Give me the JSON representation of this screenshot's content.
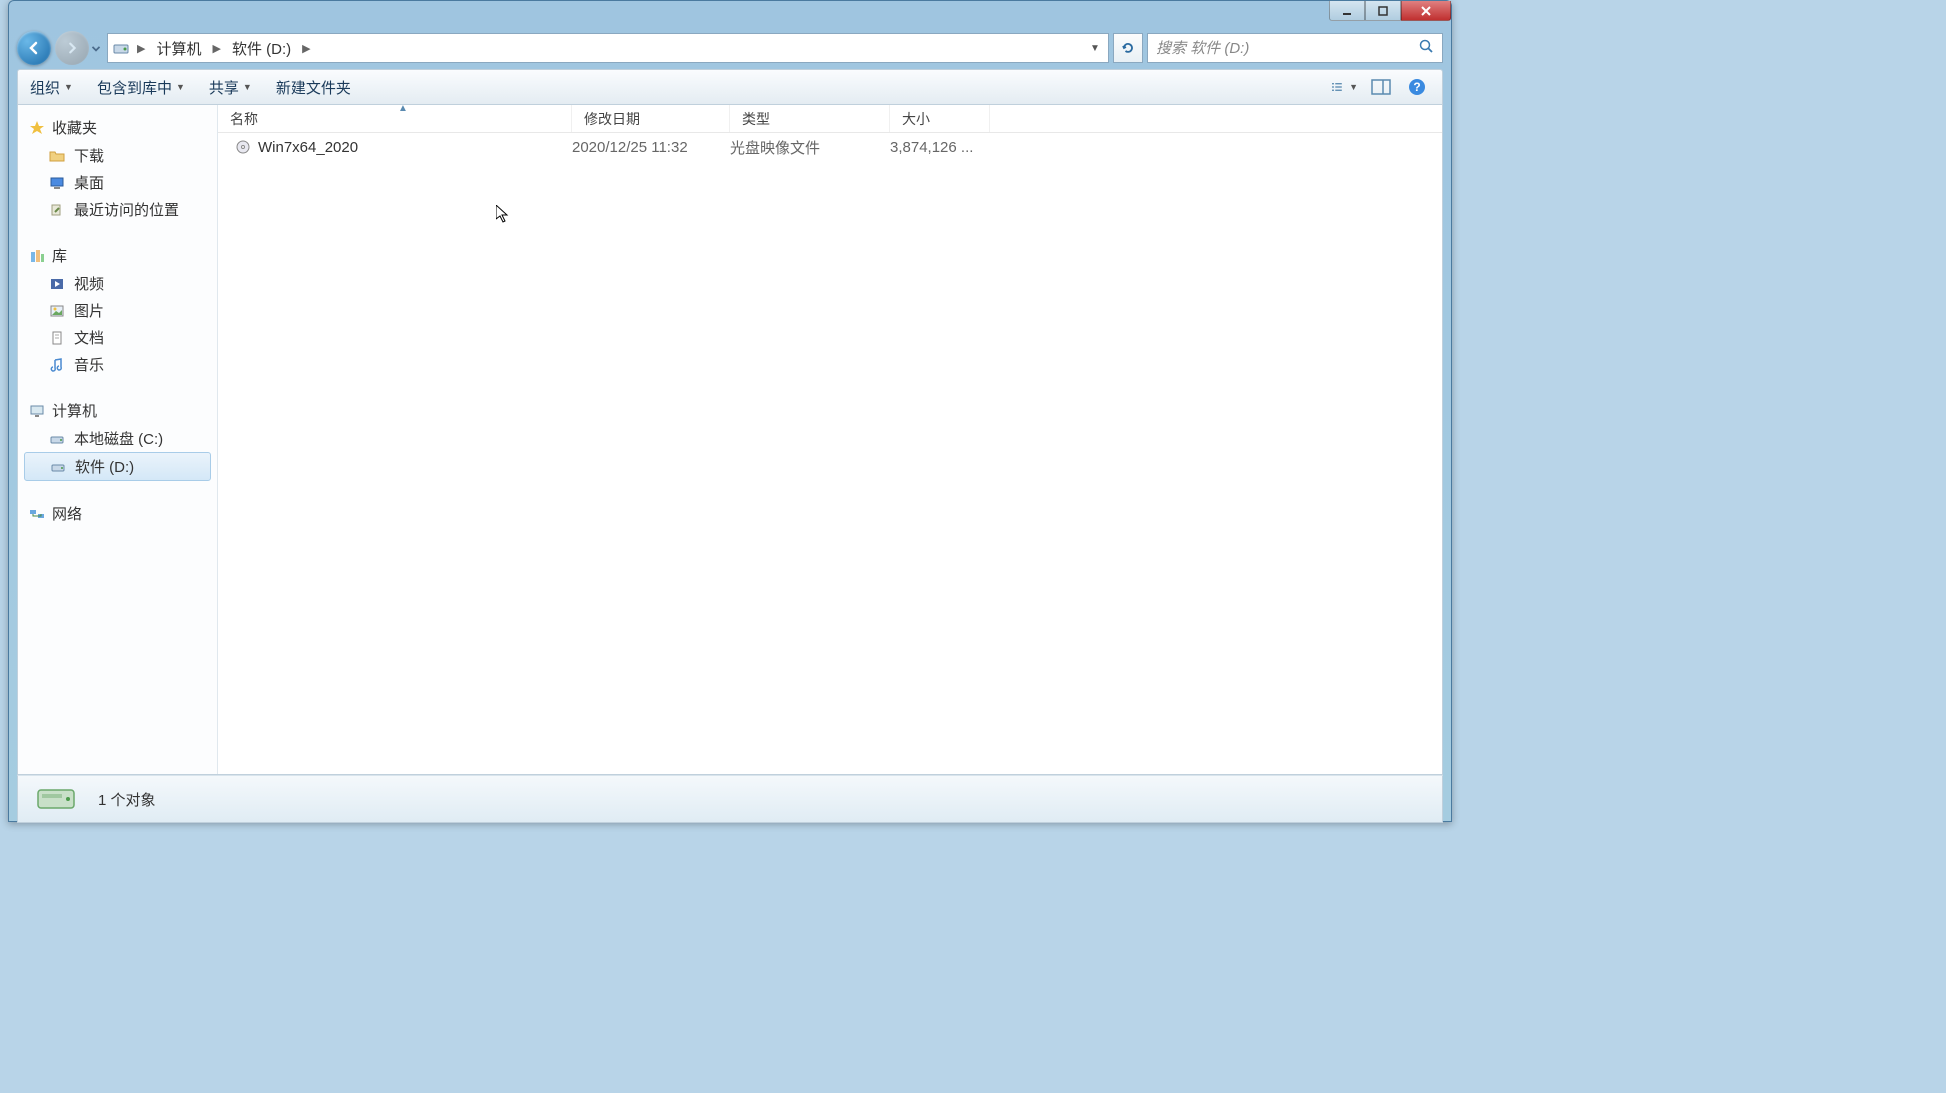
{
  "breadcrumb": {
    "seg1": "计算机",
    "seg2": "软件 (D:)"
  },
  "search": {
    "placeholder": "搜索 软件 (D:)"
  },
  "toolbar": {
    "organize": "组织",
    "include": "包含到库中",
    "share": "共享",
    "newfolder": "新建文件夹"
  },
  "sidebar": {
    "favorites": {
      "header": "收藏夹",
      "items": [
        "下载",
        "桌面",
        "最近访问的位置"
      ]
    },
    "libraries": {
      "header": "库",
      "items": [
        "视频",
        "图片",
        "文档",
        "音乐"
      ]
    },
    "computer": {
      "header": "计算机",
      "items": [
        "本地磁盘 (C:)",
        "软件 (D:)"
      ]
    },
    "network": {
      "header": "网络"
    }
  },
  "columns": {
    "name": "名称",
    "date": "修改日期",
    "type": "类型",
    "size": "大小"
  },
  "files": [
    {
      "name": "Win7x64_2020",
      "date": "2020/12/25 11:32",
      "type": "光盘映像文件",
      "size": "3,874,126 ..."
    }
  ],
  "status": {
    "text": "1 个对象"
  }
}
